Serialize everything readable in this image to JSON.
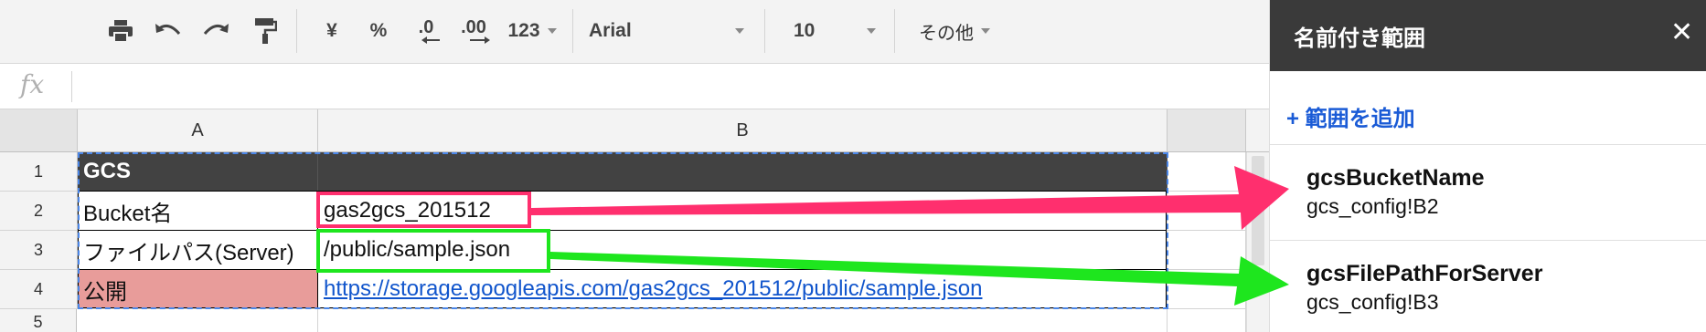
{
  "toolbar": {
    "currency_label": "¥",
    "percent_label": "%",
    "decrease_decimal_label": ".0",
    "increase_decimal_label": ".00",
    "number_format_label": "123",
    "font_name": "Arial",
    "font_size": "10",
    "more_label": "その他"
  },
  "formula_bar": {
    "fx_label": "fx",
    "value": ""
  },
  "grid": {
    "columns": [
      "A",
      "B"
    ],
    "rows": [
      {
        "num": "1",
        "a": "GCS",
        "b": ""
      },
      {
        "num": "2",
        "a": "Bucket名",
        "b": "gas2gcs_201512"
      },
      {
        "num": "3",
        "a": "ファイルパス(Server)",
        "b": "/public/sample.json"
      },
      {
        "num": "4",
        "a": "公開",
        "b": "https://storage.googleapis.com/gas2gcs_201512/public/sample.json"
      },
      {
        "num": "5",
        "a": "",
        "b": ""
      }
    ]
  },
  "panel": {
    "title": "名前付き範囲",
    "close_label": "✕",
    "add_range_label": "+ 範囲を追加",
    "named_ranges": [
      {
        "name": "gcsBucketName",
        "range": "gcs_config!B2"
      },
      {
        "name": "gcsFilePathForServer",
        "range": "gcs_config!B3"
      }
    ]
  },
  "colors": {
    "toolbar_bg": "#f3f3f3",
    "panel_header_bg": "#3a3a3a",
    "header_row_bg": "#424242",
    "public_cell_bg": "#e89c9a",
    "link": "#1155cc",
    "annotation_pink": "#ff2f6e",
    "annotation_green": "#1ee61e",
    "selection_dash": "#4a86e8"
  }
}
